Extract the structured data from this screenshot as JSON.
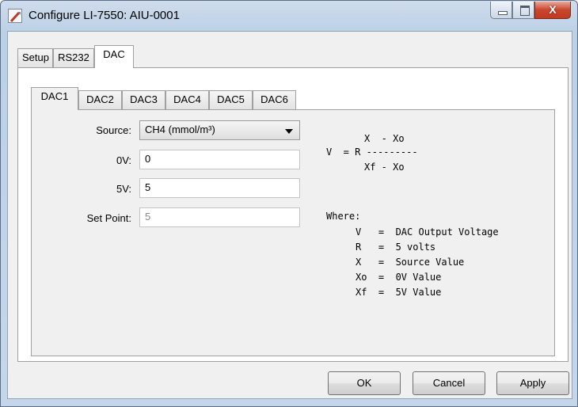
{
  "window": {
    "title": "Configure LI-7550: AIU-0001",
    "close_glyph": "X"
  },
  "outer_tabs": [
    "Setup",
    "RS232",
    "DAC"
  ],
  "outer_active": "DAC",
  "inner_tabs": [
    "DAC1",
    "DAC2",
    "DAC3",
    "DAC4",
    "DAC5",
    "DAC6"
  ],
  "inner_active": "DAC1",
  "form": {
    "source_label": "Source:",
    "source_value": "CH4 (mmol/m³)",
    "zero_label": "0V:",
    "zero_value": "0",
    "five_label": "5V:",
    "five_value": "5",
    "setpoint_label": "Set Point:",
    "setpoint_value": "5"
  },
  "formula": {
    "top": "X  - Xo",
    "middle": "V  = R ---------",
    "bottom": "Xf - Xo",
    "where": "Where:",
    "rows": [
      "V   =  DAC Output Voltage",
      "R   =  5 volts",
      "X   =  Source Value",
      "Xo  =  0V Value",
      "Xf  =  5V Value"
    ]
  },
  "buttons": {
    "ok": "OK",
    "cancel": "Cancel",
    "apply": "Apply"
  },
  "colors": {
    "title_bar": "#c5d6ea",
    "close_button": "#c9462c",
    "panel": "#f0f0f0"
  }
}
